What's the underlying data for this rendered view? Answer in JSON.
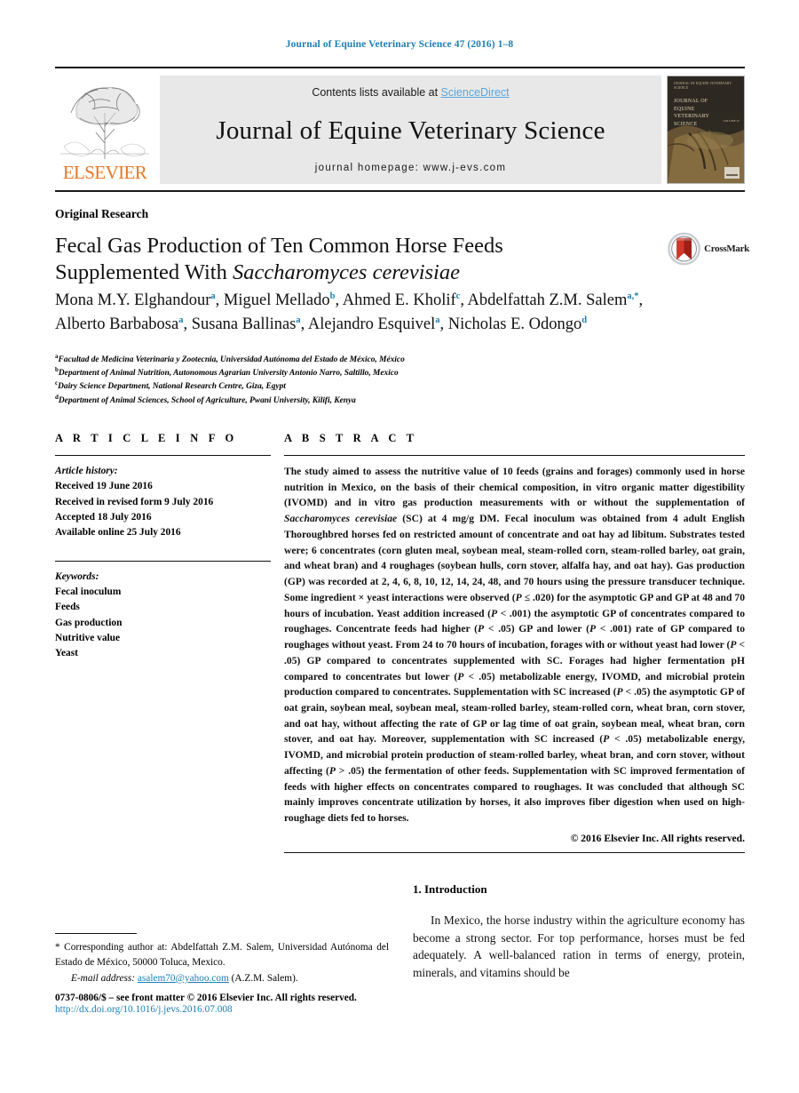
{
  "running_head": "Journal of Equine Veterinary Science 47 (2016) 1–8",
  "masthead": {
    "publisher_logo_text": "ELSEVIER",
    "contents_prefix": "Contents lists available at ",
    "contents_link": "ScienceDirect",
    "journal_title": "Journal of Equine Veterinary Science",
    "homepage": "journal homepage: www.j-evs.com",
    "cover": {
      "top_text": "JOURNAL OF EQUINE\nVETERINARY SCIENCE",
      "title_text": "JOURNAL OF EQUINE VETERINARY SCIENCE",
      "volume_label": "VOLUME 47"
    }
  },
  "article": {
    "type": "Original Research",
    "title_line1": "Fecal Gas Production of Ten Common Horse Feeds",
    "title_line2_prefix": "Supplemented With ",
    "title_line2_italic": "Saccharomyces cerevisiae",
    "crossmark_label": "CrossMark",
    "authors_line1": "Mona M.Y. Elghandour",
    "authors": [
      {
        "name": "Mona M.Y. Elghandour",
        "sup": "a"
      },
      {
        "name": "Miguel Mellado",
        "sup": "b"
      },
      {
        "name": "Ahmed E. Kholif",
        "sup": "c"
      },
      {
        "name": "Abdelfattah Z.M. Salem",
        "sup": "a,*"
      },
      {
        "name": "Alberto Barbabosa",
        "sup": "a"
      },
      {
        "name": "Susana Ballinas",
        "sup": "a"
      },
      {
        "name": "Alejandro Esquivel",
        "sup": "a"
      },
      {
        "name": "Nicholas E. Odongo",
        "sup": "d"
      }
    ],
    "affiliations": [
      {
        "mark": "a",
        "text": "Facultad de Medicina Veterinaria y Zootecnia, Universidad Autónoma del Estado de México, México"
      },
      {
        "mark": "b",
        "text": "Department of Animal Nutrition, Autonomous Agrarian University Antonio Narro, Saltillo, Mexico"
      },
      {
        "mark": "c",
        "text": "Dairy Science Department, National Research Centre, Giza, Egypt"
      },
      {
        "mark": "d",
        "text": "Department of Animal Sciences, School of Agriculture, Pwani University, Kilifi, Kenya"
      }
    ]
  },
  "article_info": {
    "section_label": "A R T I C L E  I N F O",
    "history_heading": "Article history:",
    "history": [
      "Received 19 June 2016",
      "Received in revised form 9 July 2016",
      "Accepted 18 July 2016",
      "Available online 25 July 2016"
    ],
    "keywords_heading": "Keywords:",
    "keywords": [
      "Fecal inoculum",
      "Feeds",
      "Gas production",
      "Nutritive value",
      "Yeast"
    ]
  },
  "abstract": {
    "section_label": "A B S T R A C T",
    "part1": "The study aimed to assess the nutritive value of 10 feeds (grains and forages) commonly used in horse nutrition in Mexico, on the basis of their chemical composition, in vitro organic matter digestibility (IVOMD) and in vitro gas production measurements with or without the supplementation of ",
    "italic1": "Saccharomyces cerevisiae",
    "part2": " (SC) at 4 mg/g DM. Fecal inoculum was obtained from 4 adult English Thoroughbred horses fed on restricted amount of concentrate and oat hay ad libitum. Substrates tested were; 6 concentrates (corn gluten meal, soybean meal, steam-rolled corn, steam-rolled barley, oat grain, and wheat bran) and 4 roughages (soybean hulls, corn stover, alfalfa hay, and oat hay). Gas production (GP) was recorded at 2, 4, 6, 8, 10, 12, 14, 24, 48, and 70 hours using the pressure transducer technique. Some ingredient × yeast interactions were observed (",
    "italic2": "P",
    "part3": " ≤ .020) for the asymptotic GP and GP at 48 and 70 hours of incubation. Yeast addition increased (",
    "italic3": "P",
    "part4": " < .001) the asymptotic GP of concentrates compared to roughages. Concentrate feeds had higher (",
    "italic4": "P",
    "part5": " < .05) GP and lower (",
    "italic5": "P",
    "part6": " < .001) rate of GP compared to roughages without yeast. From 24 to 70 hours of incubation, forages with or without yeast had lower (",
    "italic6": "P",
    "part7": " < .05) GP compared to concentrates supplemented with SC. Forages had higher fermentation pH compared to concentrates but lower (",
    "italic7": "P",
    "part8": " < .05) metabolizable energy, IVOMD, and microbial protein production compared to concentrates. Supplementation with SC increased (",
    "italic8": "P",
    "part9": " < .05) the asymptotic GP of oat grain, soybean meal, soybean meal, steam-rolled barley, steam-rolled corn, wheat bran, corn stover, and oat hay, without affecting the rate of GP or lag time of oat grain, soybean meal, wheat bran, corn stover, and oat hay. Moreover, supplementation with SC increased (",
    "italic9": "P",
    "part10": " < .05) metabolizable energy, IVOMD, and microbial protein production of steam-rolled barley, wheat bran, and corn stover, without affecting (",
    "italic10": "P",
    "part11": " > .05) the fermentation of other feeds. Supplementation with SC improved fermentation of feeds with higher effects on concentrates compared to roughages. It was concluded that although SC mainly improves concentrate utilization by horses, it also improves fiber digestion when used on high-roughage diets fed to horses.",
    "copyright": "© 2016 Elsevier Inc. All rights reserved."
  },
  "introduction": {
    "heading": "1. Introduction",
    "paragraph": "In Mexico, the horse industry within the agriculture economy has become a strong sector. For top performance, horses must be fed adequately. A well-balanced ration in terms of energy, protein, minerals, and vitamins should be"
  },
  "footer": {
    "corresponding_note": "* Corresponding author at: Abdelfattah Z.M. Salem, Universidad Autónoma del Estado de México, 50000 Toluca, Mexico.",
    "email_label": "E-mail address:",
    "email": "asalem70@yahoo.com",
    "email_suffix": " (A.Z.M. Salem).",
    "issn_line": "0737-0806/$ – see front matter © 2016 Elsevier Inc. All rights reserved.",
    "doi": "http://dx.doi.org/10.1016/j.jevs.2016.07.008"
  },
  "colors": {
    "link_blue": "#1b7fb5",
    "sciencedirect_blue": "#5aa5dd",
    "elsevier_orange": "#e87722",
    "band_gray": "#e8e8e8"
  }
}
